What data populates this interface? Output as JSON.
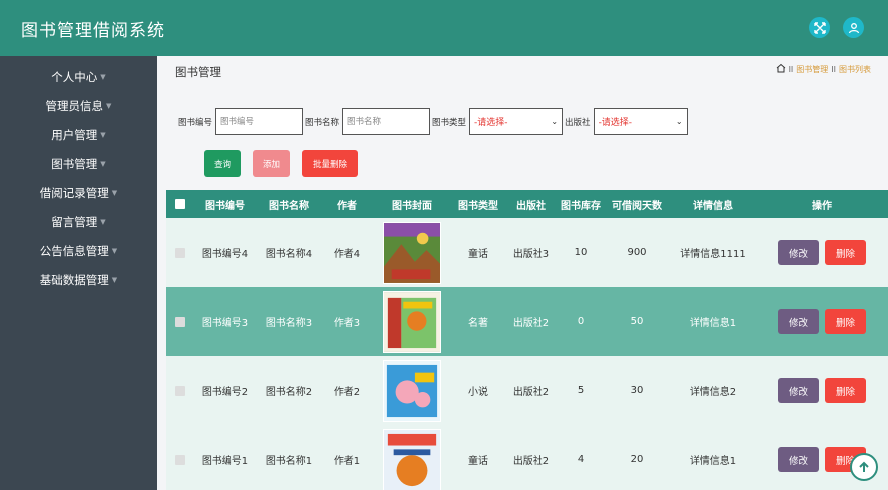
{
  "app": {
    "title": "图书管理借阅系统"
  },
  "header": {
    "icons": [
      "fullscreen-icon",
      "user-icon"
    ]
  },
  "sidebar": {
    "items": [
      {
        "label": "个人中心"
      },
      {
        "label": "管理员信息"
      },
      {
        "label": "用户管理"
      },
      {
        "label": "图书管理"
      },
      {
        "label": "借阅记录管理"
      },
      {
        "label": "留言管理"
      },
      {
        "label": "公告信息管理"
      },
      {
        "label": "基础数据管理"
      }
    ]
  },
  "page": {
    "title": "图书管理"
  },
  "breadcrumb": {
    "sep": "II",
    "items": [
      "图书管理",
      "图书列表"
    ]
  },
  "search": {
    "book_no_label": "图书编号",
    "book_no_placeholder": "图书编号",
    "book_name_label": "图书名称",
    "book_name_placeholder": "图书名称",
    "book_type_label": "图书类型",
    "book_type_value": "-请选择-",
    "publisher_label": "出版社",
    "publisher_value": "-请选择-"
  },
  "buttons": {
    "query": "查询",
    "add": "添加",
    "batch_delete": "批量删除"
  },
  "table": {
    "headers": [
      "图书编号",
      "图书名称",
      "作者",
      "图书封面",
      "图书类型",
      "出版社",
      "图书库存",
      "可借阅天数",
      "详情信息",
      "操作"
    ],
    "rows": [
      {
        "no": "图书编号4",
        "name": "图书名称4",
        "author": "作者4",
        "type": "童话",
        "publisher": "出版社3",
        "stock": "10",
        "days": "900",
        "detail": "详情信息1111"
      },
      {
        "no": "图书编号3",
        "name": "图书名称3",
        "author": "作者3",
        "type": "名著",
        "publisher": "出版社2",
        "stock": "0",
        "days": "50",
        "detail": "详情信息1"
      },
      {
        "no": "图书编号2",
        "name": "图书名称2",
        "author": "作者2",
        "type": "小说",
        "publisher": "出版社2",
        "stock": "5",
        "days": "30",
        "detail": "详情信息2"
      },
      {
        "no": "图书编号1",
        "name": "图书名称1",
        "author": "作者1",
        "type": "童话",
        "publisher": "出版社2",
        "stock": "4",
        "days": "20",
        "detail": "详情信息1"
      }
    ],
    "edit_label": "修改",
    "delete_label": "删除"
  },
  "colors": {
    "brand": "#2e8f7e",
    "sidebar": "#3c4751",
    "danger": "#f2453c",
    "edit": "#6e5c82"
  }
}
